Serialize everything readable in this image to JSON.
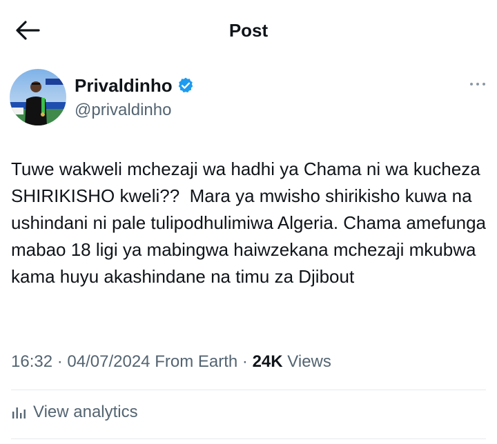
{
  "header": {
    "title": "Post",
    "back_icon": "arrow-left-icon"
  },
  "author": {
    "name": "Privaldinho",
    "handle": "@privaldinho",
    "verified_icon": "verified-badge-icon",
    "verified_color": "#1d9bf0"
  },
  "tweet": {
    "text": "Tuwe wakweli mchezaji wa hadhi ya Chama ni wa kucheza SHIRIKISHO kweli??  Mara ya mwisho shirikisho kuwa na ushindani ni pale tulipodhulimiwa Algeria. Chama amefunga mabao 18 ligi ya mabingwa haiwzekana mchezaji mkubwa kama huyu akashindane na timu za Djibout"
  },
  "meta": {
    "time": "16:32",
    "separator": "·",
    "date": "04/07/2024",
    "source": "From Earth",
    "views_count": "24K",
    "views_label": "Views"
  },
  "analytics": {
    "label": "View analytics",
    "icon": "bar-chart-icon"
  },
  "colors": {
    "text_primary": "#0f1419",
    "text_secondary": "#536471",
    "divider": "#e6e9ec"
  }
}
